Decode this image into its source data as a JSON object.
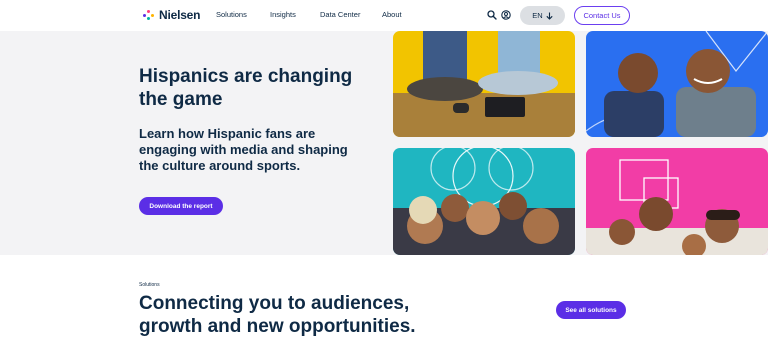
{
  "header": {
    "logo_text": "Nielsen",
    "nav": [
      "Solutions",
      "Insights",
      "Data Center",
      "About"
    ],
    "search_icon": "search-icon",
    "account_icon": "user-circle-icon",
    "lang_label": "EN",
    "lang_icon": "arrow-down-icon",
    "contact_label": "Contact Us"
  },
  "hero": {
    "title": "Hispanics are changing the game",
    "subtitle": "Learn how Hispanic fans are engaging with media and shaping the culture around sports.",
    "cta_label": "Download the report",
    "photos": [
      {
        "name": "hero-photo-friends-sitting",
        "background": "#f2c400"
      },
      {
        "name": "hero-photo-men-celebrating",
        "background": "#2a6ff0"
      },
      {
        "name": "hero-photo-group-selfie",
        "background": "#1fb6c1"
      },
      {
        "name": "hero-photo-family",
        "background": "#f23da6"
      }
    ]
  },
  "solutions": {
    "label": "Solutions",
    "title": "Connecting you to audiences, growth and new opportunities.",
    "cta_label": "See all solutions"
  },
  "colors": {
    "primary": "#5b2ee6",
    "navy": "#0f2a45",
    "hero_bg": "#f3f3f5"
  }
}
